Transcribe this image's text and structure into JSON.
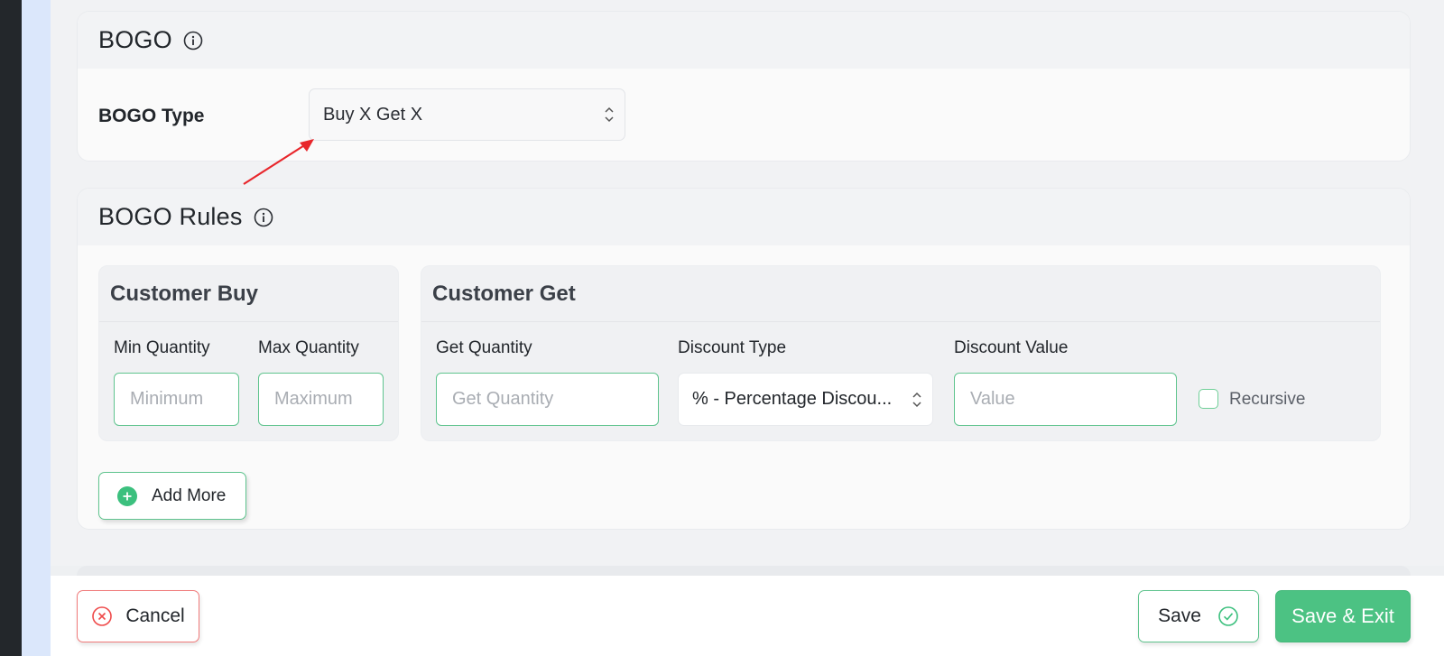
{
  "bogo_section": {
    "title": "BOGO",
    "type_label": "BOGO Type",
    "type_value": "Buy X Get X"
  },
  "rules_section": {
    "title": "BOGO Rules",
    "customer_buy": {
      "title": "Customer Buy",
      "min_label": "Min Quantity",
      "min_placeholder": "Minimum",
      "max_label": "Max Quantity",
      "max_placeholder": "Maximum"
    },
    "customer_get": {
      "title": "Customer Get",
      "get_qty_label": "Get Quantity",
      "get_qty_placeholder": "Get Quantity",
      "discount_type_label": "Discount Type",
      "discount_type_value": "% - Percentage Discou...",
      "discount_value_label": "Discount Value",
      "discount_value_placeholder": "Value",
      "recursive_label": "Recursive"
    },
    "add_more_label": "Add More"
  },
  "footer": {
    "cancel_label": "Cancel",
    "save_label": "Save",
    "save_exit_label": "Save & Exit"
  },
  "colors": {
    "accent_green": "#4cc283",
    "cancel_red": "#f07a7a",
    "annotation_arrow": "#e8262b"
  },
  "icons": [
    "info-icon",
    "updown-caret-icon",
    "plus-circle-icon",
    "close-circle-icon",
    "check-circle-icon"
  ]
}
